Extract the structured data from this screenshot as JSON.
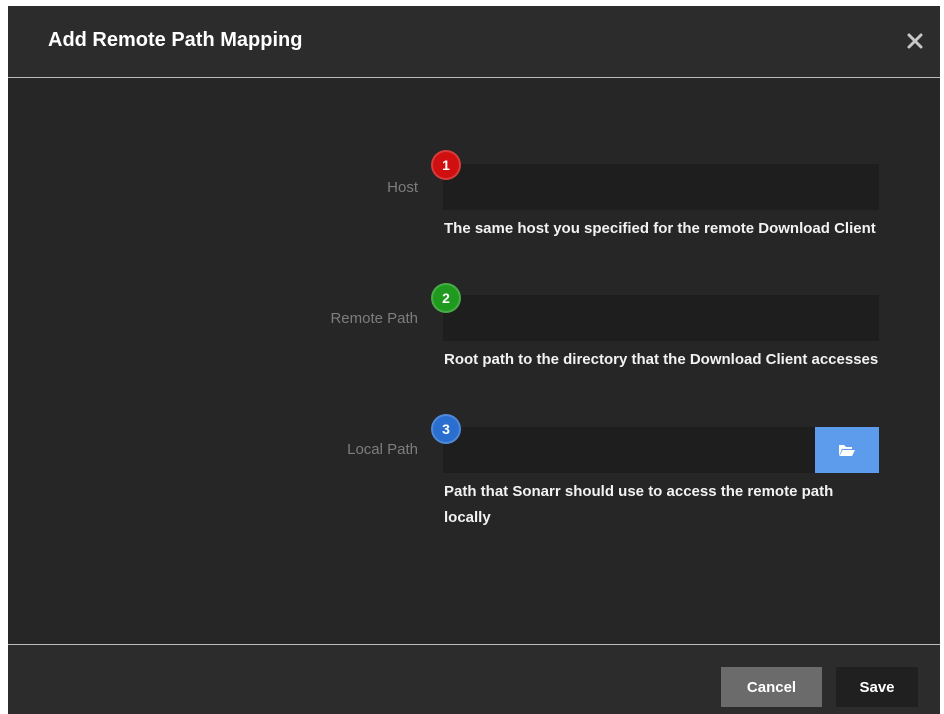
{
  "dialog": {
    "title": "Add Remote Path Mapping",
    "close_icon": "close-icon"
  },
  "fields": {
    "host": {
      "label": "Host",
      "badge": "1",
      "badge_color": "#d01010",
      "value": "",
      "help": "The same host you specified for the remote Download Client"
    },
    "remote_path": {
      "label": "Remote Path",
      "badge": "2",
      "badge_color": "#1f9a1f",
      "value": "",
      "help": "Root path to the directory that the Download Client accesses"
    },
    "local_path": {
      "label": "Local Path",
      "badge": "3",
      "badge_color": "#2a6fd0",
      "value": "",
      "help": "Path that Sonarr should use to access the remote path locally",
      "browse_icon": "folder-open-icon"
    }
  },
  "footer": {
    "cancel_label": "Cancel",
    "save_label": "Save"
  },
  "colors": {
    "accent": "#5d9cec",
    "background": "#262626"
  }
}
